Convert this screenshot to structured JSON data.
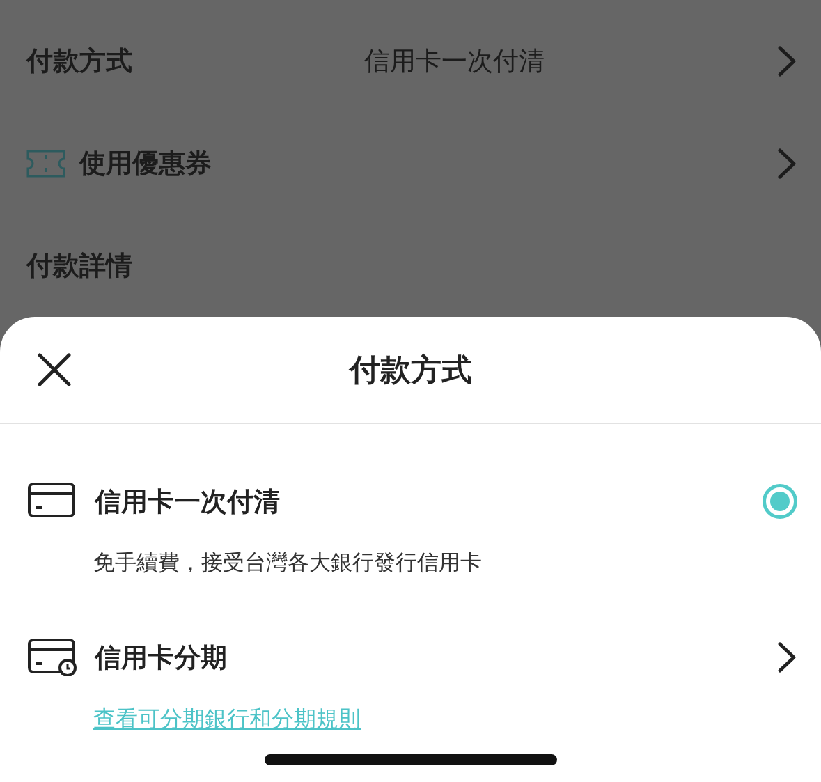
{
  "background": {
    "rows": [
      {
        "kind": "value",
        "label": "付款方式",
        "value": "信用卡一次付清"
      },
      {
        "kind": "coupon",
        "label": "使用優惠券"
      },
      {
        "kind": "heading",
        "label": "付款詳情"
      }
    ]
  },
  "sheet": {
    "title": "付款方式",
    "options": [
      {
        "kind": "radio",
        "title": "信用卡一次付清",
        "subtitle": "免手續費，接受台灣各大銀行發行信用卡",
        "selected": true
      },
      {
        "kind": "installment",
        "title": "信用卡分期",
        "link": "查看可分期銀行和分期規則"
      }
    ]
  }
}
